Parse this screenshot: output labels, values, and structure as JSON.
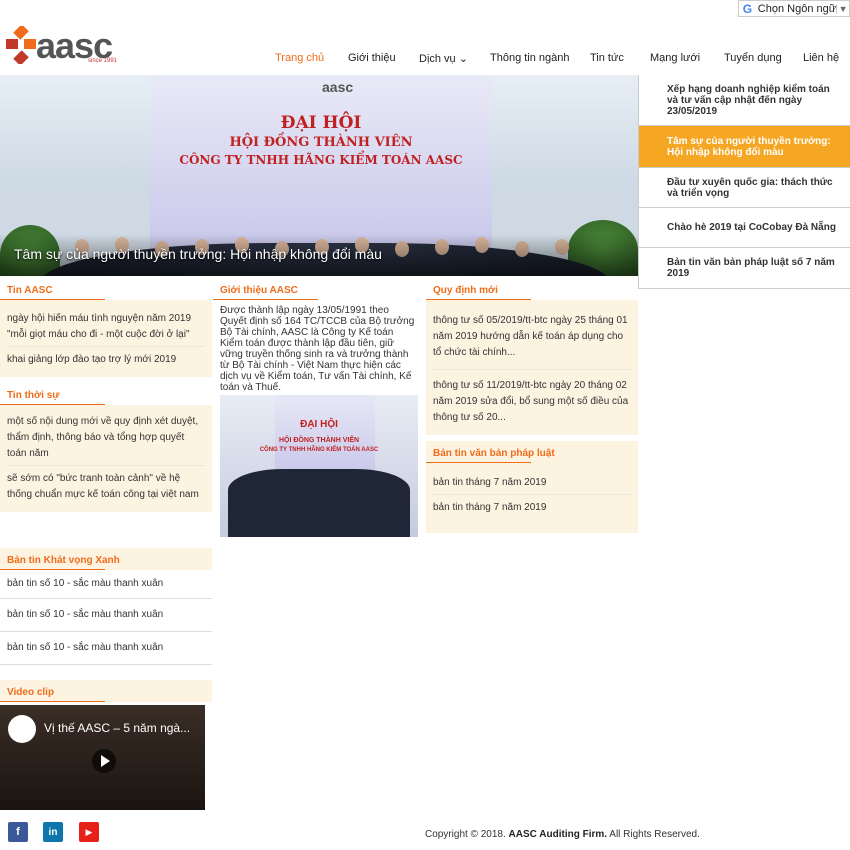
{
  "language": {
    "label": "Chọn Ngôn ngữ"
  },
  "logo": {
    "word": "aasc",
    "since": "since 1991"
  },
  "nav": [
    {
      "label": "Trang chủ",
      "active": true
    },
    {
      "label": "Giới thiệu"
    },
    {
      "label": "Dịch vụ ⌄"
    },
    {
      "label": "Thông tin ngành"
    },
    {
      "label": "Tin tức"
    },
    {
      "label": "Mạng lưới"
    },
    {
      "label": "Tuyển dụng"
    },
    {
      "label": "Liên hệ"
    }
  ],
  "hero": {
    "banner_line1": "ĐẠI HỘI",
    "banner_line2": "HỘI ĐỒNG THÀNH VIÊN",
    "banner_line3": "CÔNG TY TNHH HÃNG KIỂM TOÁN AASC",
    "caption": "Tâm sự của người thuyền trưởng: Hội nhập không đổi màu"
  },
  "side_news": [
    {
      "title": "Xếp hạng doanh nghiệp kiểm toán và tư vấn cập nhật đến ngày 23/05/2019"
    },
    {
      "title": "Tâm sự của người thuyền trưởng: Hội nhập không đổi màu",
      "active": true
    },
    {
      "title": "Đầu tư xuyên quốc gia: thách thức và triển vọng"
    },
    {
      "title": "Chào hè 2019 tại CoCobay Đà Nẵng"
    },
    {
      "title": "Bản tin văn bản pháp luật số 7 năm 2019"
    }
  ],
  "tin_aasc": {
    "title": "Tin AASC",
    "items": [
      "ngày hội hiến máu tình nguyện năm 2019 \"mỗi giọt máu cho đi - một cuộc đời ở lại\"",
      "khai giảng lớp đào tạo trợ lý mới 2019"
    ]
  },
  "tin_thoi_su": {
    "title": "Tin thời sự",
    "items": [
      "một số nội dung mới về quy định xét duyệt, thẩm định, thông báo và tổng hợp quyết toán năm",
      "sẽ sớm có \"bức tranh toàn cảnh\" về hệ thống chuẩn mực kế toán công tại việt nam"
    ]
  },
  "khat_vong": {
    "title": "Bản tin Khát vọng Xanh",
    "items": [
      "bản tin số 10 - sắc màu thanh xuân",
      "bản tin số 10 - sắc màu thanh xuân",
      "bản tin số 10 - sắc màu thanh xuân"
    ]
  },
  "video": {
    "title": "Video clip",
    "video_title": "Vị thế AASC – 5 năm ngà..."
  },
  "gioi_thieu": {
    "title": "Giới thiệu AASC",
    "text": "Được thành lập ngày 13/05/1991 theo Quyết định số 164 TC/TCCB của Bộ trưởng Bộ Tài chính, AASC là Công ty Kế toán Kiểm toán được thành lập đầu tiên, giữ vững truyền thống sinh ra và trưởng thành từ Bộ Tài chính - Việt Nam thực hiện các dịch vụ về Kiểm toán, Tư vấn Tài chính, Kế toán và Thuế."
  },
  "quy_dinh": {
    "title": "Quy định mới",
    "items": [
      "thông tư số 05/2019/tt-btc ngày 25 tháng 01 năm 2019 hướng dẫn kế toán áp dụng cho tổ chức tài chính...",
      "thông tư số 11/2019/tt-btc ngày 20 tháng 02 năm 2019 sửa đổi, bổ sung một số điều của thông tư số 20..."
    ]
  },
  "ban_tin_phap_luat": {
    "title": "Bản tin văn bản pháp luật",
    "items": [
      "bản tin tháng 7 năm 2019",
      "bản tin tháng 7 năm 2019"
    ]
  },
  "footer": {
    "facebook": "f",
    "linkedin": "in",
    "youtube": "▶",
    "copyright_prefix": "Copyright © 2018.",
    "copyright_firm": "AASC Auditing Firm.",
    "copyright_suffix": "All Rights Reserved."
  },
  "colors": {
    "accent": "#ef6c1a",
    "highlight": "#f5a623",
    "box_bg": "#fdf3e1"
  }
}
